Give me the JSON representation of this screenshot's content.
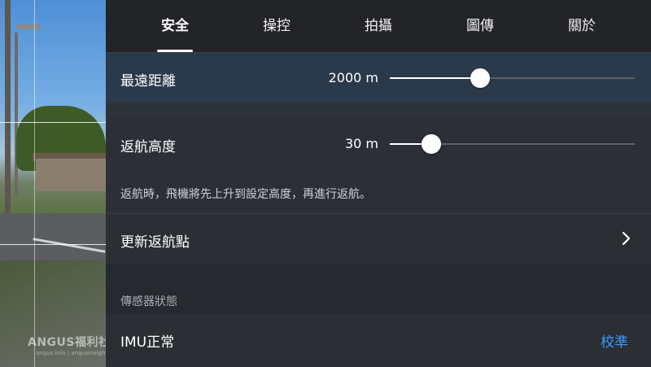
{
  "tabs": [
    {
      "label": "安全",
      "active": true
    },
    {
      "label": "操控",
      "active": false
    },
    {
      "label": "拍攝",
      "active": false
    },
    {
      "label": "圖傳",
      "active": false
    },
    {
      "label": "關於",
      "active": false
    }
  ],
  "max_distance": {
    "label": "最遠距離",
    "value": "2000 m",
    "slider_fraction": 0.37
  },
  "rth_altitude": {
    "label": "返航高度",
    "value": "30 m",
    "slider_fraction": 0.17,
    "description": "返航時，飛機將先上升到設定高度，再進行返航。"
  },
  "update_home_point": {
    "label": "更新返航點",
    "icon": "chevron-right-icon"
  },
  "sensor_section": {
    "title": "傳感器狀態"
  },
  "imu": {
    "label": "IMU正常",
    "action": "校準"
  },
  "watermark": {
    "text": "ANGUS福利社",
    "subtext": "angus.info | angusinsights.com"
  },
  "colors": {
    "accent": "#3a9bff",
    "panel_bg": "#26292d",
    "highlight_row": "#2a3a4a"
  }
}
